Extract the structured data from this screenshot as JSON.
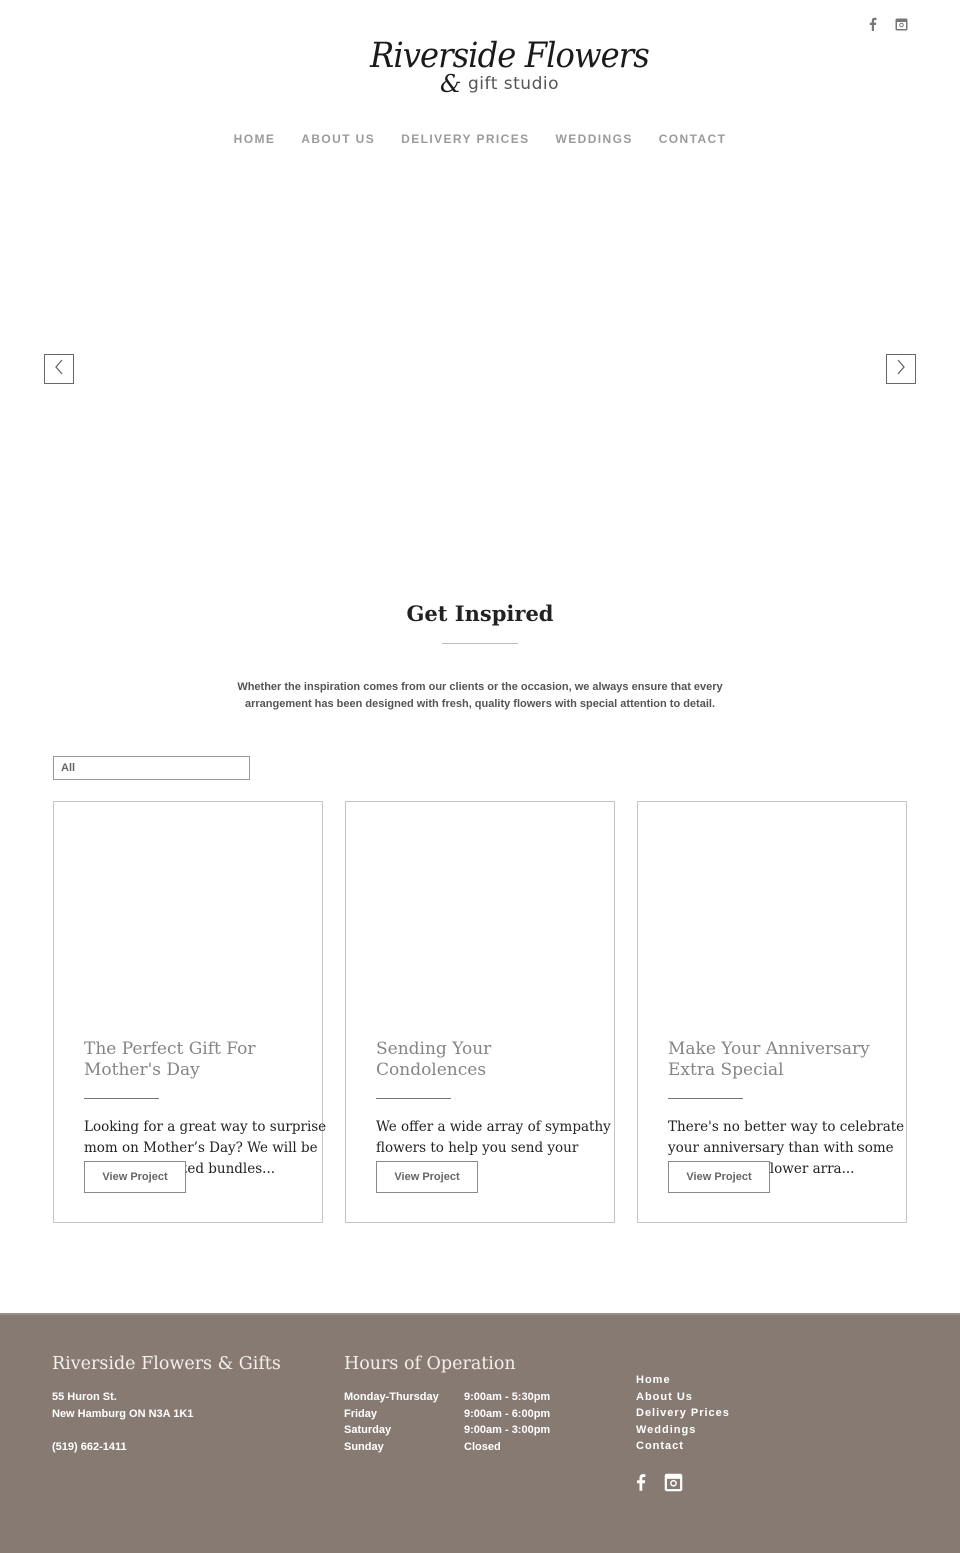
{
  "header": {
    "logo": {
      "main": "Riverside Flowers",
      "amp": "&",
      "sub": "gift studio"
    },
    "social": [
      {
        "name": "facebook-icon"
      },
      {
        "name": "instagram-icon"
      }
    ],
    "nav": [
      "HOME",
      "ABOUT US",
      "DELIVERY PRICES",
      "WEDDINGS",
      "CONTACT"
    ]
  },
  "slider": {
    "prev_icon": "chevron-left-icon",
    "next_icon": "chevron-right-icon"
  },
  "inspired": {
    "title": "Get Inspired",
    "text": "Whether the inspiration comes from our clients or the occasion, we always ensure that every arrangement has been designed with fresh, quality flowers with special attention to detail."
  },
  "filter": {
    "value": "All"
  },
  "cards": [
    {
      "title": "The Perfect Gift For Mother's Day",
      "excerpt": "Looking for a great way to surprise mom on Mother’s Day? We will be creating assorted bundles...",
      "button": "View Project"
    },
    {
      "title": "Sending Your Condolences",
      "excerpt": "We offer a wide array of sympathy flowers to help you send your",
      "button": "View Project"
    },
    {
      "title": "Make Your Anniversary Extra Special",
      "excerpt": "There's no better way to celebrate your anniversary than with some fresh, vibrant flower arra...",
      "button": "View Project"
    }
  ],
  "footer": {
    "company": {
      "title": "Riverside Flowers & Gifts",
      "street": "55 Huron St.",
      "city": "New Hamburg ON N3A 1K1",
      "phone": "(519) 662-1411"
    },
    "hours": {
      "title": "Hours of Operation",
      "rows": [
        {
          "day": "Monday-Thursday",
          "time": "9:00am - 5:30pm"
        },
        {
          "day": "Friday",
          "time": "9:00am - 6:00pm"
        },
        {
          "day": "Saturday",
          "time": "9:00am - 3:00pm"
        },
        {
          "day": "Sunday",
          "time": "Closed"
        }
      ]
    },
    "links": [
      "Home",
      "About Us",
      "Delivery Prices",
      "Weddings",
      "Contact"
    ],
    "colors": {
      "background": "#877a73"
    }
  }
}
